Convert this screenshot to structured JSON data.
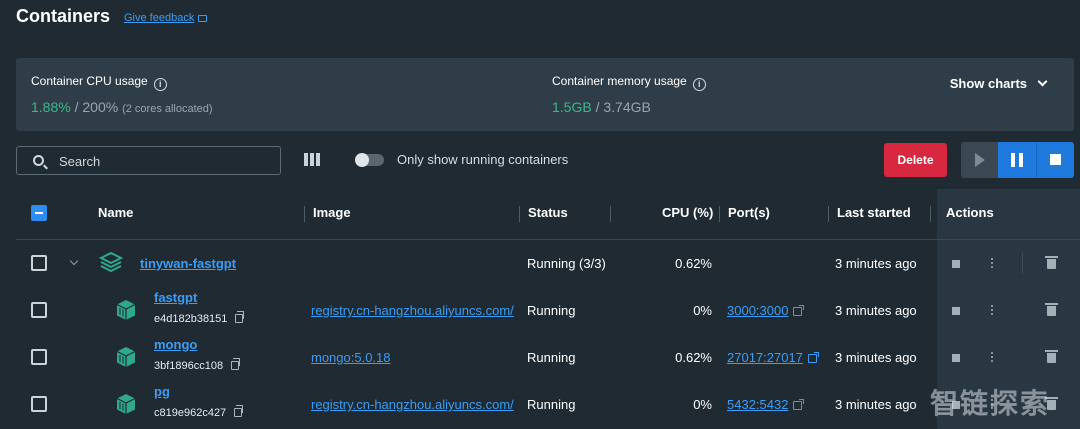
{
  "header": {
    "title": "Containers",
    "feedback": "Give feedback"
  },
  "stats": {
    "cpu_label": "Container CPU usage",
    "cpu_used": "1.88%",
    "cpu_total": " / 200%",
    "cpu_note": "(2 cores allocated)",
    "mem_label": "Container memory usage",
    "mem_used": "1.5GB",
    "mem_total": " / 3.74GB",
    "show_charts": "Show charts"
  },
  "toolbar": {
    "search_placeholder": "Search",
    "toggle_label": "Only show running containers",
    "delete_label": "Delete"
  },
  "columns": [
    "Name",
    "Image",
    "Status",
    "CPU (%)",
    "Port(s)",
    "Last started",
    "Actions"
  ],
  "rows": [
    {
      "name": "tinywan-fastgpt",
      "status": "Running (3/3)",
      "cpu": "0.62%",
      "started": "3 minutes ago"
    },
    {
      "name": "fastgpt",
      "id": "e4d182b38151",
      "image": "registry.cn-hangzhou.aliyuncs.com/",
      "status": "Running",
      "cpu": "0%",
      "port": "3000:3000",
      "started": "3 minutes ago"
    },
    {
      "name": "mongo",
      "id": "3bf1896cc108",
      "image": "mongo:5.0.18",
      "status": "Running",
      "cpu": "0.62%",
      "port": "27017:27017",
      "started": "3 minutes ago"
    },
    {
      "name": "pg",
      "id": "c819e962c427",
      "image": "registry.cn-hangzhou.aliyuncs.com/",
      "status": "Running",
      "cpu": "0%",
      "port": "5432:5432",
      "started": "3 minutes ago"
    }
  ],
  "colors": {
    "accent": "#1f7ae0",
    "link": "#3d9df5",
    "danger": "#d8283f",
    "green": "#3cb88a",
    "cube": "#2fa88e"
  },
  "watermark": "智链探索"
}
